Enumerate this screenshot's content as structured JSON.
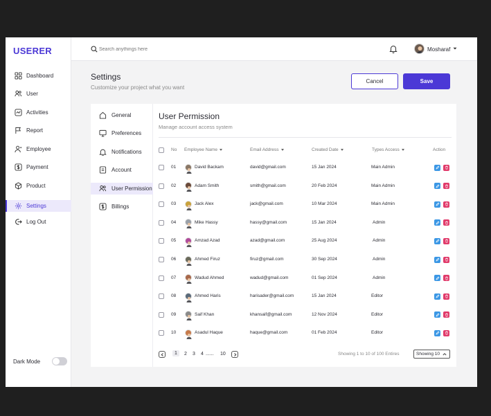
{
  "brand": "USERER",
  "sidebar": {
    "items": [
      {
        "label": "Dashboard",
        "icon": "grid-icon"
      },
      {
        "label": "User",
        "icon": "users-icon"
      },
      {
        "label": "Activities",
        "icon": "activity-icon"
      },
      {
        "label": "Report",
        "icon": "flag-icon"
      },
      {
        "label": "Employee",
        "icon": "employee-icon"
      },
      {
        "label": "Payment",
        "icon": "dollar-icon"
      },
      {
        "label": "Product",
        "icon": "box-icon"
      },
      {
        "label": "Settings",
        "icon": "gear-icon",
        "active": true
      },
      {
        "label": "Log Out",
        "icon": "logout-icon"
      }
    ],
    "dark_mode_label": "Dark Mode"
  },
  "topbar": {
    "search_placeholder": "Search anythings here",
    "user_name": "Mosharaf"
  },
  "header": {
    "title": "Settings",
    "subtitle": "Customize your project what you want",
    "cancel_label": "Cancel",
    "save_label": "Save"
  },
  "settings_nav": [
    {
      "label": "General",
      "icon": "home-icon"
    },
    {
      "label": "Preferences",
      "icon": "monitor-icon"
    },
    {
      "label": "Notifications",
      "icon": "bell-icon"
    },
    {
      "label": "Account",
      "icon": "id-card-icon"
    },
    {
      "label": "User Permission",
      "icon": "users-icon",
      "active": true
    },
    {
      "label": "Billings",
      "icon": "dollar-icon"
    }
  ],
  "permission": {
    "title": "User Permission",
    "subtitle": "Manage account access system",
    "columns": [
      "No",
      "Employee Name",
      "Email Address",
      "Created Date",
      "Types Access",
      "Action"
    ],
    "rows": [
      {
        "no": "01",
        "name": "David Backam",
        "email": "david@gmail.com",
        "date": "15 Jan 2024",
        "access": "Main Admin",
        "avatar_color": "#8a7766"
      },
      {
        "no": "02",
        "name": "Adam Smith",
        "email": "smith@gmail.com",
        "date": "20 Feb 2024",
        "access": "Main Admin",
        "avatar_color": "#6a4a3a"
      },
      {
        "no": "03",
        "name": "Jack Alex",
        "email": "jack@gmail.com",
        "date": "10 Mar 2024",
        "access": "Main Admin",
        "avatar_color": "#c9a23a"
      },
      {
        "no": "04",
        "name": "Mike Hassy",
        "email": "hassy@gmail.com",
        "date": "15 Jan 2024",
        "access": "Admin",
        "avatar_color": "#9aa0a8"
      },
      {
        "no": "05",
        "name": "Amzad Azad",
        "email": "azad@gmail.com",
        "date": "25 Aug 2024",
        "access": "Admin",
        "avatar_color": "#b04a9a"
      },
      {
        "no": "06",
        "name": "Ahmed Firuz",
        "email": "firuz@gmail.com",
        "date": "30 Sep 2024",
        "access": "Admin",
        "avatar_color": "#6a6a5a"
      },
      {
        "no": "07",
        "name": "Wadud Ahmed",
        "email": "wadud@gmail.com",
        "date": "01 Sep 2024",
        "access": "Admin",
        "avatar_color": "#a8684a"
      },
      {
        "no": "08",
        "name": "Ahmed Haris",
        "email": "harisader@gmail.com",
        "date": "15 Jan 2024",
        "access": "Editor",
        "avatar_color": "#5a6a7a"
      },
      {
        "no": "09",
        "name": "Saif Khan",
        "email": "khansaif@gmail.com",
        "date": "12 Nov 2024",
        "access": "Editor",
        "avatar_color": "#8a8a8a"
      },
      {
        "no": "10",
        "name": "Asadul Haque",
        "email": "haque@gmail.com",
        "date": "01 Feb 2024",
        "access": "Editor",
        "avatar_color": "#c77a4a"
      }
    ]
  },
  "pagination": {
    "pages": [
      "1",
      "2",
      "3",
      "4",
      "......",
      "10"
    ],
    "current": "1",
    "entries_text": "Showing 1 to 10 of 100 Entires",
    "page_size_label": "Showing 10"
  },
  "colors": {
    "accent": "#4b38d6",
    "edit": "#3b97e5",
    "delete": "#e13b6b"
  }
}
